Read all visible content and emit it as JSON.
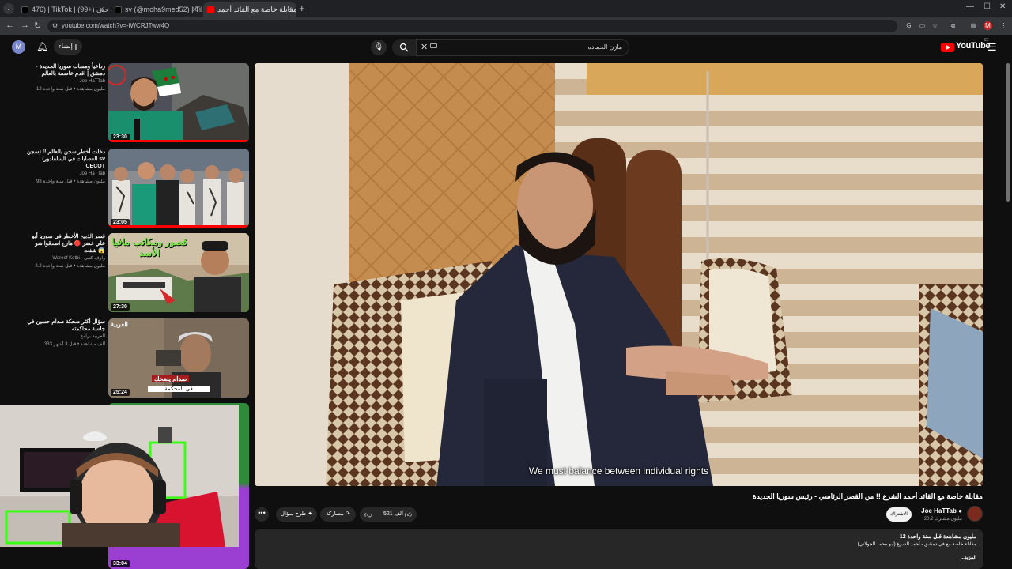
{
  "browser": {
    "tabs": [
      {
        "title": "476) | TikTok | وطن بيحبي (+99)",
        "favicon": "tiktok-icon"
      },
      {
        "title": "sv (@moha9med52) | TikTok ?",
        "favicon": "tiktok-icon"
      },
      {
        "title": "مقابلة خاصة مع القائد أحمد !",
        "favicon": "youtube-icon"
      }
    ],
    "url": "youtube.com/watch?v=-iWCRJTww4Q",
    "new_tab": "+"
  },
  "header": {
    "avatar_letter": "M",
    "create_label": "إنشاء",
    "search_query": "مازن الحماده",
    "logo_text": "YouTube",
    "logo_region": "SE"
  },
  "recommendations": [
    {
      "title": "رداعيأ ومسات سوريا الجديدة - دمشق | اقدم عاصمة بالعالم",
      "channel": "Joe HaTTab",
      "stats": "12 مليون مشاهدة • قبل سنة واحدة",
      "duration": "23:30"
    },
    {
      "title": "دخلت أخطر سجن بالعالم !! (سجن العصابات في السلفادور) sv CECOT",
      "channel": "Joe HaTTab",
      "stats": "98 مليون مشاهدة • قبل سنة واحدة",
      "duration": "23:05"
    },
    {
      "title": "قصر الذبيح الأخطر في سوريا أبو علي خضر 🔴 هارج اصدقوا شو شفت 😱",
      "channel": "Wareef Kotbi - وارف كتبي",
      "stats": "2.2 مليون مشاهدة • قبل سنة واحدة",
      "duration": "27:30",
      "overlay": "قصور ومكاتب مافيا الأسد"
    },
    {
      "title": "سؤال أكثر ضحكة صدام حسين في جلسة محاكمته",
      "channel": "العربية برامج",
      "stats": "333 ألف مشاهدة • قبل 3 أشهر",
      "duration": "25:24",
      "overlay_top": "العربية",
      "overlay_caption": "صدام يضحك",
      "overlay_sub": "في المحكمة"
    },
    {
      "title": "",
      "channel": "",
      "stats": "",
      "duration": "33:04"
    }
  ],
  "player": {
    "subtitle": "We must balance between individual rights"
  },
  "video": {
    "title": "مقابلة خاصة مع القائد أحمد الشرع !! من القصر الرئاسي - رئيس سوريا الجديدة",
    "channel": "Joe HaTTab",
    "subscribers": "20.2 مليون مشترك",
    "subscribe_label": "الاشتراك",
    "likes": "521 ألف",
    "share_label": "مشاركة",
    "ask_label": "طرح سؤال",
    "more_label": "•••",
    "description_stats": "12 مليون مشاهدة  قبل سنة واحدة",
    "description_text": "مقابلة خاصة مع في دمشق - أحمد الشرع (أبو محمد الجولاني)",
    "description_more": "...المزيد"
  },
  "colors": {
    "accent": "#ff0000",
    "background": "#0f0f0f",
    "surface": "#272727"
  }
}
